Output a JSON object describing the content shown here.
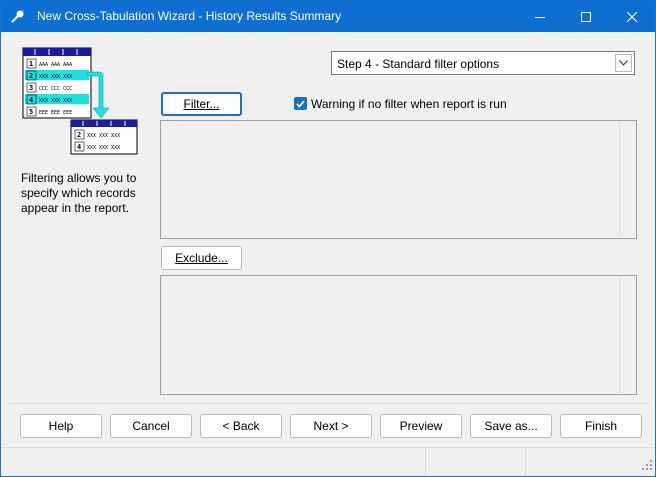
{
  "window": {
    "title": "New Cross-Tabulation Wizard - History Results Summary",
    "controls": {
      "minimize": "minimize-icon",
      "maximize": "maximize-icon",
      "close": "close-icon"
    }
  },
  "step_selector": {
    "value": "Step 4 - Standard filter options"
  },
  "filter": {
    "button_label": "Filter...",
    "warning_label": "Warning if no filter when report is run",
    "warning_checked": true
  },
  "exclude": {
    "button_label": "Exclude..."
  },
  "description": "Filtering allows you to specify which records appear in the report.",
  "illustration": {
    "rows": [
      {
        "num": "1",
        "text": "AAA AAA AAA"
      },
      {
        "num": "2",
        "text": "XXX XXX XXX"
      },
      {
        "num": "3",
        "text": "CCC CCC CCC"
      },
      {
        "num": "4",
        "text": "XXX XXX XXX"
      },
      {
        "num": "5",
        "text": "EEE EEE EEE"
      }
    ],
    "extracted_rows": [
      {
        "num": "2",
        "text": "XXX XXX XXX"
      },
      {
        "num": "4",
        "text": "XXX XXX XXX"
      }
    ]
  },
  "buttons": {
    "help": "Help",
    "cancel": "Cancel",
    "back": "< Back",
    "next": "Next >",
    "preview": "Preview",
    "save_as": "Save as...",
    "finish": "Finish"
  },
  "colors": {
    "title_bar": "#0c6fd1",
    "highlight_rows": "#19e3e3",
    "checkbox": "#1b6ec7"
  }
}
